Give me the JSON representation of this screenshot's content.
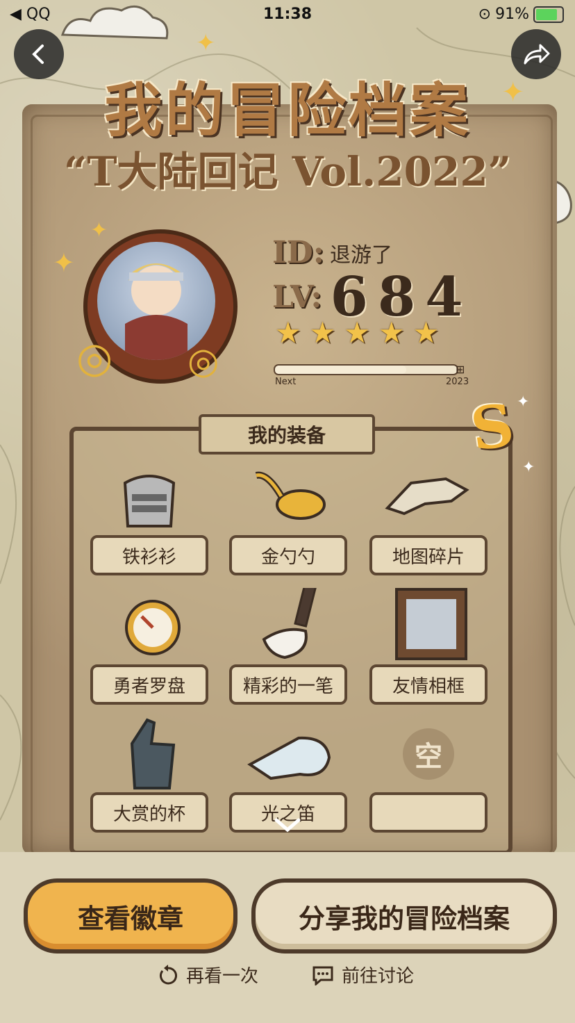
{
  "status_bar": {
    "carrier": "◀ QQ",
    "time": "11:38",
    "battery": "91%"
  },
  "header": {
    "title": "我的冒险档案",
    "subtitle": "“T大陆回记 Vol.2022”"
  },
  "profile": {
    "id_key": "ID:",
    "id_value": "退游了",
    "lv_key": "LV:",
    "level": "684",
    "stars": 5,
    "progress_start": "Next",
    "progress_end": "2023",
    "progress_fraction": 0.72
  },
  "equipment": {
    "title": "我的装备",
    "count": "S",
    "items": [
      {
        "label": "铁衫衫",
        "icon": "armor-icon"
      },
      {
        "label": "金勺勺",
        "icon": "golden-spoon-icon"
      },
      {
        "label": "地图碎片",
        "icon": "map-fragment-icon"
      },
      {
        "label": "勇者罗盘",
        "icon": "compass-icon"
      },
      {
        "label": "精彩的一笔",
        "icon": "brush-icon"
      },
      {
        "label": "友情相框",
        "icon": "photo-frame-icon"
      },
      {
        "label": "大赏的杯",
        "icon": "thumbs-up-icon"
      },
      {
        "label": "光之笛",
        "icon": "whistle-icon"
      },
      {
        "label": "",
        "icon": "empty-slot-icon",
        "empty_text": "空"
      }
    ]
  },
  "actions": {
    "view_badges": "查看徽章",
    "share": "分享我的冒险档案",
    "replay": "再看一次",
    "discuss": "前往讨论"
  },
  "colors": {
    "primary_button": "#f0b44e",
    "secondary_button": "#e8dcc2",
    "parchment": "#b9a27c",
    "ink": "#3b2a1c"
  }
}
